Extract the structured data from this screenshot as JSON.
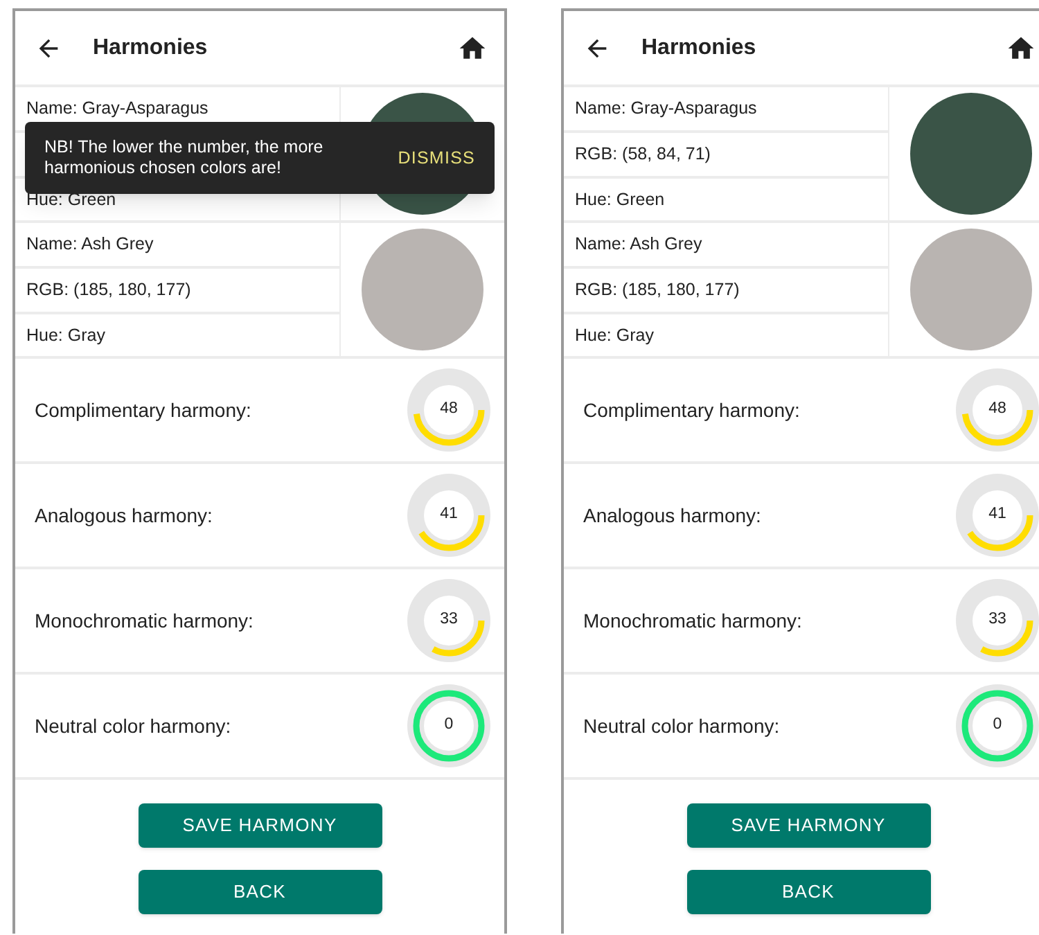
{
  "screens": [
    {
      "title": "Harmonies",
      "snackbar": {
        "message": "NB! The lower the number, the more harmonious chosen colors are!",
        "action": "DISMISS"
      },
      "colors": [
        {
          "name": "Name: Gray-Asparagus",
          "hue": "Hue: Green",
          "color": "#3a5447"
        },
        {
          "name": "Name: Ash Grey",
          "rgb": "RGB: (185, 180, 177)",
          "hue": "Hue: Gray",
          "color": "#b9b4b1"
        }
      ],
      "harmonies": [
        {
          "label": "Complimentary harmony:",
          "value": "48",
          "level": 0.48,
          "color": "#ffdd00"
        },
        {
          "label": "Analogous harmony:",
          "value": "41",
          "level": 0.41,
          "color": "#ffdd00"
        },
        {
          "label": "Monochromatic harmony:",
          "value": "33",
          "level": 0.33,
          "color": "#ffdd00"
        },
        {
          "label": "Neutral color harmony:",
          "value": "0",
          "level": 1,
          "color": "#1de97a"
        }
      ],
      "buttons": [
        "SAVE HARMONY",
        "BACK"
      ]
    },
    {
      "title": "Harmonies",
      "colors": [
        {
          "name": "Name: Gray-Asparagus",
          "rgb": "RGB: (58, 84, 71)",
          "hue": "Hue: Green",
          "color": "#3a5447"
        },
        {
          "name": "Name: Ash Grey",
          "rgb": "RGB: (185, 180, 177)",
          "hue": "Hue: Gray",
          "color": "#b9b4b1"
        }
      ],
      "harmonies": [
        {
          "label": "Complimentary harmony:",
          "value": "48",
          "level": 0.48,
          "color": "#ffdd00"
        },
        {
          "label": "Analogous harmony:",
          "value": "41",
          "level": 0.41,
          "color": "#ffdd00"
        },
        {
          "label": "Monochromatic harmony:",
          "value": "33",
          "level": 0.33,
          "color": "#ffdd00"
        },
        {
          "label": "Neutral color harmony:",
          "value": "0",
          "level": 1,
          "color": "#1de97a"
        }
      ],
      "buttons": [
        "SAVE HARMONY",
        "BACK"
      ]
    }
  ]
}
